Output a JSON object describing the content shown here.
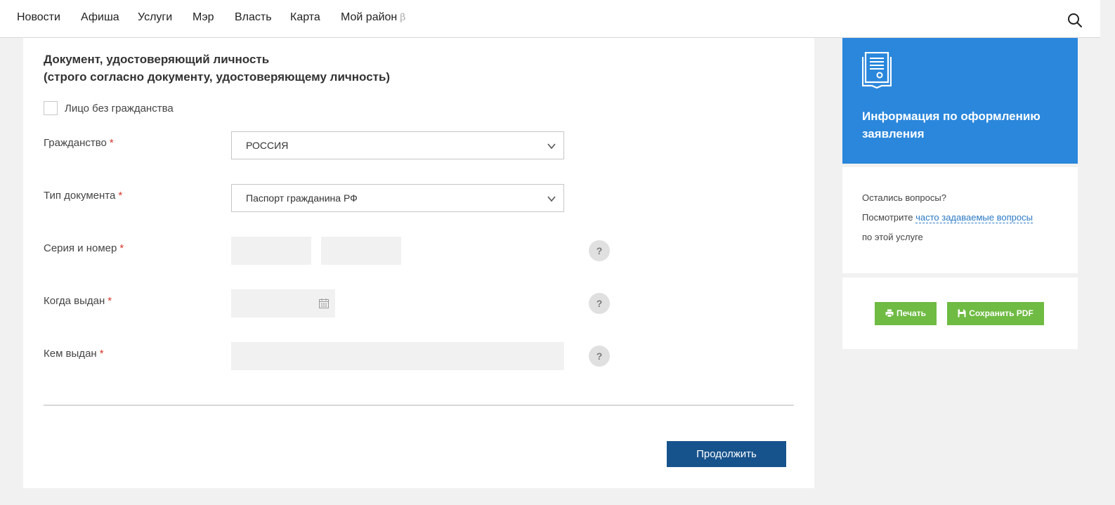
{
  "nav": {
    "items": [
      "Новости",
      "Афиша",
      "Услуги",
      "Мэр",
      "Власть",
      "Карта",
      "Мой район"
    ],
    "beta_mark": "β",
    "search_icon": "search-icon"
  },
  "form": {
    "title_line1": "Документ, удостоверяющий личность",
    "title_line2": "(строго согласно документу, удостоверяющему личность)",
    "stateless_checkbox_label": "Лицо без гражданства",
    "required_mark": "*",
    "citizenship": {
      "label": "Гражданство",
      "value": "РОССИЯ"
    },
    "doc_type": {
      "label": "Тип документа",
      "value": "Паспорт гражданина РФ"
    },
    "series_number": {
      "label": "Серия и номер",
      "series_value": "",
      "number_value": ""
    },
    "issue_date": {
      "label": "Когда выдан",
      "value": ""
    },
    "issued_by": {
      "label": "Кем выдан",
      "value": ""
    },
    "help_mark": "?",
    "continue_label": "Продолжить"
  },
  "sidebar": {
    "info_title": "Информация по оформлению заявления",
    "faq_line1": "Остались вопросы?",
    "faq_line2_prefix": "Посмотрите",
    "faq_link": "часто задаваемые вопросы",
    "faq_line3": "по этой услуге",
    "print_label": "Печать",
    "pdf_label": "Сохранить PDF"
  },
  "colors": {
    "info_card": "#2a87dc",
    "continue_button": "#16528c",
    "action_buttons": "#6fbb43",
    "required": "#d9352b"
  }
}
